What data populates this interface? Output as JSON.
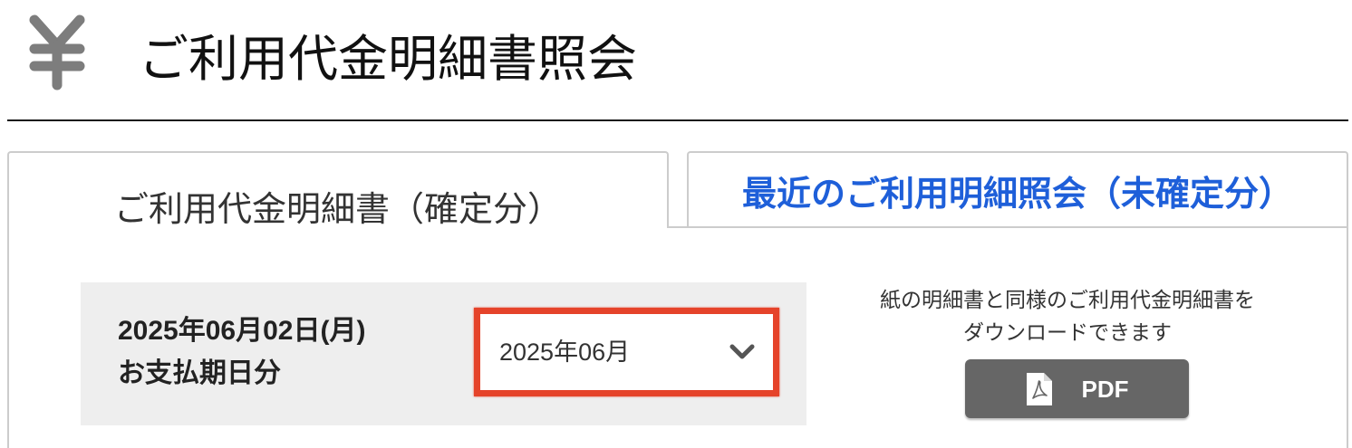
{
  "header": {
    "icon": "yen-icon",
    "title": "ご利用代金明細書照会"
  },
  "tabs": [
    {
      "label": "ご利用代金明細書（確定分）",
      "active": true
    },
    {
      "label": "最近のご利用明細照会（未確定分）",
      "active": false
    }
  ],
  "statement": {
    "due_date": "2025年06月02日(月)",
    "due_suffix": "お支払期日分",
    "month_select": {
      "selected": "2025年06月",
      "icon": "chevron-down-icon"
    }
  },
  "download": {
    "description": [
      "紙の明細書と同様のご利用代金明細書を",
      "ダウンロードできます"
    ],
    "button": {
      "label": "PDF",
      "icon": "pdf-file-icon"
    }
  },
  "colors": {
    "text": "#333333",
    "link_blue": "#1e5fd9",
    "icon_gray": "#7d7d7d",
    "border_gray": "#cccccc",
    "panel_gray": "#eeeeee",
    "button_gray": "#666666",
    "highlight_red": "#e5432a"
  }
}
